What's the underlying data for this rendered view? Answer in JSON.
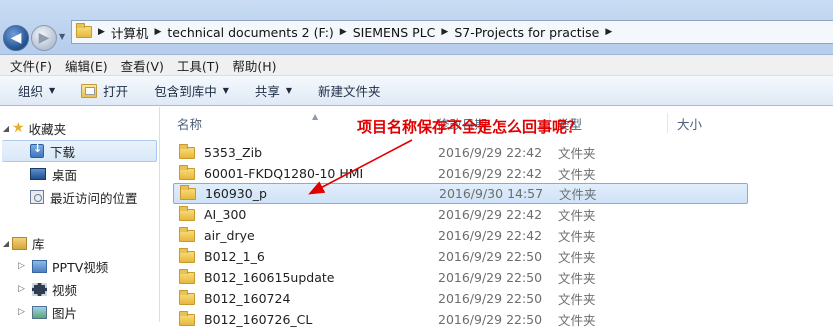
{
  "address_bar": {
    "breadcrumbs": [
      "计算机",
      "technical documents 2 (F:)",
      "SIEMENS PLC",
      "S7-Projects for practise"
    ]
  },
  "menu": {
    "items": [
      "文件(F)",
      "编辑(E)",
      "查看(V)",
      "工具(T)",
      "帮助(H)"
    ]
  },
  "toolbar": {
    "organize_label": "组织",
    "open_label": "打开",
    "include_label": "包含到库中",
    "share_label": "共享",
    "new_folder_label": "新建文件夹"
  },
  "nav": {
    "favorites_label": "收藏夹",
    "downloads_label": "下载",
    "desktop_label": "桌面",
    "recent_label": "最近访问的位置",
    "libraries_label": "库",
    "pptv_label": "PPTV视频",
    "videos_label": "视频",
    "pictures_label": "图片"
  },
  "columns": {
    "name": "名称",
    "date": "修改日期",
    "type": "类型",
    "size": "大小"
  },
  "files": [
    {
      "name": "5353_Zib",
      "date": "2016/9/29 22:42",
      "type": "文件夹"
    },
    {
      "name": "60001-FKDQ1280-10 HMI",
      "date": "2016/9/29 22:42",
      "type": "文件夹"
    },
    {
      "name": "160930_p",
      "date": "2016/9/30 14:57",
      "type": "文件夹"
    },
    {
      "name": "AI_300",
      "date": "2016/9/29 22:42",
      "type": "文件夹"
    },
    {
      "name": "air_drye",
      "date": "2016/9/29 22:42",
      "type": "文件夹"
    },
    {
      "name": "B012_1_6",
      "date": "2016/9/29 22:50",
      "type": "文件夹"
    },
    {
      "name": "B012_160615update",
      "date": "2016/9/29 22:50",
      "type": "文件夹"
    },
    {
      "name": "B012_160724",
      "date": "2016/9/29 22:50",
      "type": "文件夹"
    },
    {
      "name": "B012_160726_CL",
      "date": "2016/9/29 22:50",
      "type": "文件夹"
    }
  ],
  "annotation": {
    "text": "项目名称保存不全是怎么回事呢？",
    "color": "#e00000"
  }
}
